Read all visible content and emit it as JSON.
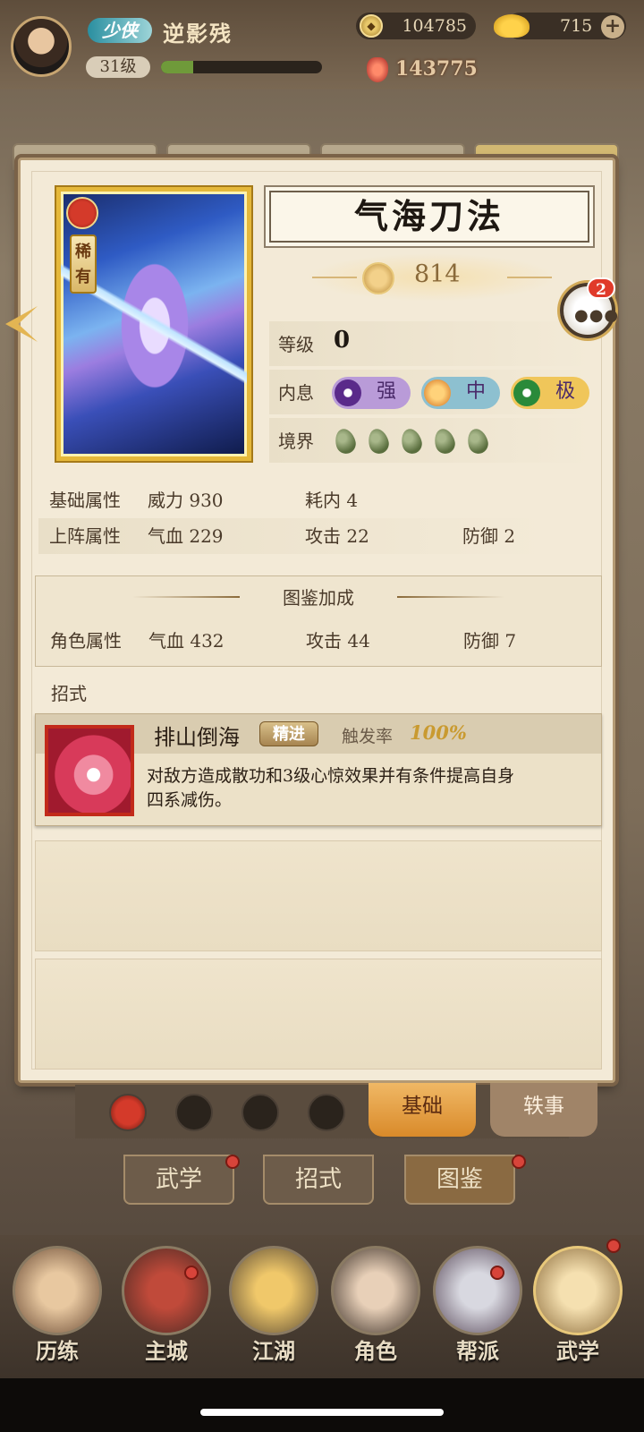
{
  "header": {
    "vip": "少侠",
    "player_name": "逆影残",
    "level": "31级",
    "xp_progress": 0.2,
    "coins": "104785",
    "ingots": "715",
    "combat_power": "143775"
  },
  "skill": {
    "name": "气海刀法",
    "rarity": "稀有",
    "power": "814",
    "level_label": "等级",
    "level_value": "0",
    "neixi_label": "内息",
    "neixi": [
      {
        "text": "强",
        "color": "#b99bd8"
      },
      {
        "text": "中",
        "color": "#8dc0d0"
      },
      {
        "text": "极",
        "color": "#f0c65a"
      }
    ],
    "realm_label": "境界",
    "realm_stars": 5
  },
  "base_stats": {
    "label": "基础属性",
    "items": [
      "威力 930",
      "耗内 4"
    ]
  },
  "battle_stats": {
    "label": "上阵属性",
    "items": [
      "气血 229",
      "攻击 22",
      "防御 2"
    ]
  },
  "collection": {
    "title": "图鉴加成",
    "label": "角色属性",
    "items": [
      "气血 432",
      "攻击 44",
      "防御 7"
    ]
  },
  "moves": {
    "label": "招式",
    "name": "排山倒海",
    "tag": "精进",
    "trigger_label": "触发率",
    "trigger_value": "100%",
    "desc": "对敌方造成散功和3级心惊效果并有条件提高自身四系减伤。"
  },
  "chat_badge": "2",
  "detail_tabs": [
    "基础",
    "轶事"
  ],
  "page_tabs": [
    "武学",
    "招式",
    "图鉴"
  ],
  "nav": [
    "历练",
    "主城",
    "江湖",
    "角色",
    "帮派",
    "武学"
  ]
}
